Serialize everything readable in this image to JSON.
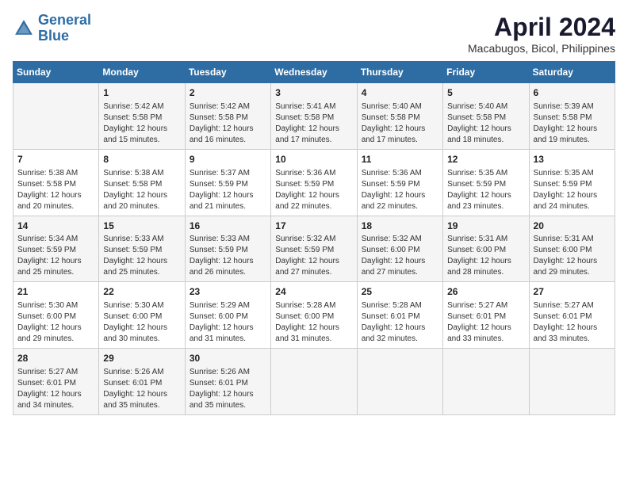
{
  "header": {
    "logo_line1": "General",
    "logo_line2": "Blue",
    "month": "April 2024",
    "location": "Macabugos, Bicol, Philippines"
  },
  "days_of_week": [
    "Sunday",
    "Monday",
    "Tuesday",
    "Wednesday",
    "Thursday",
    "Friday",
    "Saturday"
  ],
  "weeks": [
    [
      {
        "day": "",
        "info": ""
      },
      {
        "day": "1",
        "info": "Sunrise: 5:42 AM\nSunset: 5:58 PM\nDaylight: 12 hours\nand 15 minutes."
      },
      {
        "day": "2",
        "info": "Sunrise: 5:42 AM\nSunset: 5:58 PM\nDaylight: 12 hours\nand 16 minutes."
      },
      {
        "day": "3",
        "info": "Sunrise: 5:41 AM\nSunset: 5:58 PM\nDaylight: 12 hours\nand 17 minutes."
      },
      {
        "day": "4",
        "info": "Sunrise: 5:40 AM\nSunset: 5:58 PM\nDaylight: 12 hours\nand 17 minutes."
      },
      {
        "day": "5",
        "info": "Sunrise: 5:40 AM\nSunset: 5:58 PM\nDaylight: 12 hours\nand 18 minutes."
      },
      {
        "day": "6",
        "info": "Sunrise: 5:39 AM\nSunset: 5:58 PM\nDaylight: 12 hours\nand 19 minutes."
      }
    ],
    [
      {
        "day": "7",
        "info": "Sunrise: 5:38 AM\nSunset: 5:58 PM\nDaylight: 12 hours\nand 20 minutes."
      },
      {
        "day": "8",
        "info": "Sunrise: 5:38 AM\nSunset: 5:58 PM\nDaylight: 12 hours\nand 20 minutes."
      },
      {
        "day": "9",
        "info": "Sunrise: 5:37 AM\nSunset: 5:59 PM\nDaylight: 12 hours\nand 21 minutes."
      },
      {
        "day": "10",
        "info": "Sunrise: 5:36 AM\nSunset: 5:59 PM\nDaylight: 12 hours\nand 22 minutes."
      },
      {
        "day": "11",
        "info": "Sunrise: 5:36 AM\nSunset: 5:59 PM\nDaylight: 12 hours\nand 22 minutes."
      },
      {
        "day": "12",
        "info": "Sunrise: 5:35 AM\nSunset: 5:59 PM\nDaylight: 12 hours\nand 23 minutes."
      },
      {
        "day": "13",
        "info": "Sunrise: 5:35 AM\nSunset: 5:59 PM\nDaylight: 12 hours\nand 24 minutes."
      }
    ],
    [
      {
        "day": "14",
        "info": "Sunrise: 5:34 AM\nSunset: 5:59 PM\nDaylight: 12 hours\nand 25 minutes."
      },
      {
        "day": "15",
        "info": "Sunrise: 5:33 AM\nSunset: 5:59 PM\nDaylight: 12 hours\nand 25 minutes."
      },
      {
        "day": "16",
        "info": "Sunrise: 5:33 AM\nSunset: 5:59 PM\nDaylight: 12 hours\nand 26 minutes."
      },
      {
        "day": "17",
        "info": "Sunrise: 5:32 AM\nSunset: 5:59 PM\nDaylight: 12 hours\nand 27 minutes."
      },
      {
        "day": "18",
        "info": "Sunrise: 5:32 AM\nSunset: 6:00 PM\nDaylight: 12 hours\nand 27 minutes."
      },
      {
        "day": "19",
        "info": "Sunrise: 5:31 AM\nSunset: 6:00 PM\nDaylight: 12 hours\nand 28 minutes."
      },
      {
        "day": "20",
        "info": "Sunrise: 5:31 AM\nSunset: 6:00 PM\nDaylight: 12 hours\nand 29 minutes."
      }
    ],
    [
      {
        "day": "21",
        "info": "Sunrise: 5:30 AM\nSunset: 6:00 PM\nDaylight: 12 hours\nand 29 minutes."
      },
      {
        "day": "22",
        "info": "Sunrise: 5:30 AM\nSunset: 6:00 PM\nDaylight: 12 hours\nand 30 minutes."
      },
      {
        "day": "23",
        "info": "Sunrise: 5:29 AM\nSunset: 6:00 PM\nDaylight: 12 hours\nand 31 minutes."
      },
      {
        "day": "24",
        "info": "Sunrise: 5:28 AM\nSunset: 6:00 PM\nDaylight: 12 hours\nand 31 minutes."
      },
      {
        "day": "25",
        "info": "Sunrise: 5:28 AM\nSunset: 6:01 PM\nDaylight: 12 hours\nand 32 minutes."
      },
      {
        "day": "26",
        "info": "Sunrise: 5:27 AM\nSunset: 6:01 PM\nDaylight: 12 hours\nand 33 minutes."
      },
      {
        "day": "27",
        "info": "Sunrise: 5:27 AM\nSunset: 6:01 PM\nDaylight: 12 hours\nand 33 minutes."
      }
    ],
    [
      {
        "day": "28",
        "info": "Sunrise: 5:27 AM\nSunset: 6:01 PM\nDaylight: 12 hours\nand 34 minutes."
      },
      {
        "day": "29",
        "info": "Sunrise: 5:26 AM\nSunset: 6:01 PM\nDaylight: 12 hours\nand 35 minutes."
      },
      {
        "day": "30",
        "info": "Sunrise: 5:26 AM\nSunset: 6:01 PM\nDaylight: 12 hours\nand 35 minutes."
      },
      {
        "day": "",
        "info": ""
      },
      {
        "day": "",
        "info": ""
      },
      {
        "day": "",
        "info": ""
      },
      {
        "day": "",
        "info": ""
      }
    ]
  ]
}
